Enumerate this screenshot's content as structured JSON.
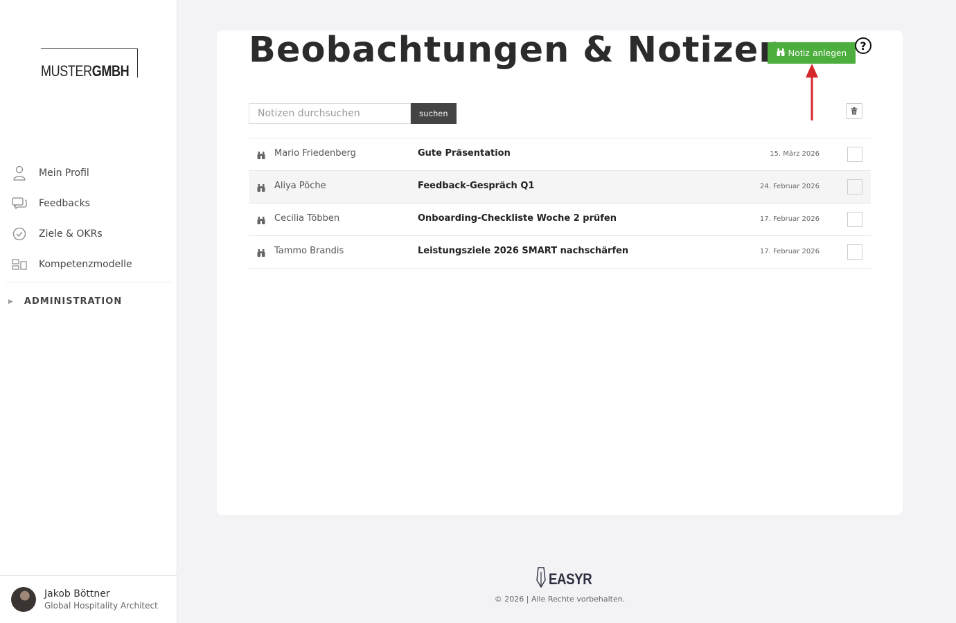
{
  "sidebar": {
    "logo": {
      "light": "MUSTER",
      "bold": "GMBH"
    },
    "items": [
      {
        "label": "Mein Profil",
        "icon": "user-icon"
      },
      {
        "label": "Feedbacks",
        "icon": "chat-icon"
      },
      {
        "label": "Ziele & OKRs",
        "icon": "check-circle-icon"
      },
      {
        "label": "Kompetenzmodelle",
        "icon": "competence-icon"
      }
    ],
    "admin_label": "ADMINISTRATION",
    "user": {
      "name": "Jakob Böttner",
      "role": "Global Hospitality Architect"
    }
  },
  "main": {
    "title": "Beobachtungen & Notizen",
    "add_button": "Notiz anlegen",
    "help_label": "?",
    "search": {
      "placeholder": "Notizen durchsuchen",
      "value": "",
      "button": "suchen"
    },
    "notes": [
      {
        "author": "Mario Friedenberg",
        "subject": "Gute Präsentation",
        "date": "15. März 2026"
      },
      {
        "author": "Aliya Pöche",
        "subject": "Feedback-Gespräch Q1",
        "date": "24. Februar 2026"
      },
      {
        "author": "Cecilia Többen",
        "subject": "Onboarding-Checkliste Woche 2 prüfen",
        "date": "17. Februar 2026"
      },
      {
        "author": "Tammo Brandis",
        "subject": "Leistungsziele 2026 SMART nachschärfen",
        "date": "17. Februar 2026"
      }
    ]
  },
  "footer": {
    "brand": "EASYR",
    "copyright": "© 2026 | Alle Rechte vorbehalten."
  },
  "colors": {
    "accent_green": "#4caf3d",
    "annotation_red": "#d6272a",
    "dark_button": "#444444"
  }
}
